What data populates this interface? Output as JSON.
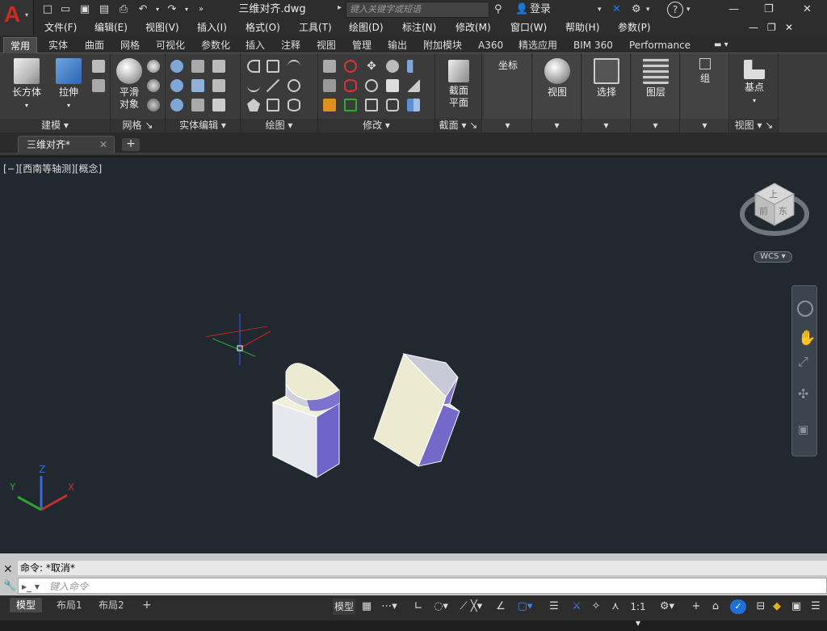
{
  "title_bar": {
    "app_menu_icon": "autocad-logo-icon",
    "document_title": "三维对齐.dwg",
    "search_placeholder": "键入关键字或短语",
    "login_label": "登录",
    "help_icon": "question-icon"
  },
  "menu_bar": {
    "items": [
      "文件(F)",
      "编辑(E)",
      "视图(V)",
      "插入(I)",
      "格式(O)",
      "工具(T)",
      "绘图(D)",
      "标注(N)",
      "修改(M)",
      "窗口(W)",
      "帮助(H)",
      "参数(P)"
    ]
  },
  "ribbon_tabs": {
    "tabs": [
      "常用",
      "实体",
      "曲面",
      "网格",
      "可视化",
      "参数化",
      "插入",
      "注释",
      "视图",
      "管理",
      "输出",
      "附加模块",
      "A360",
      "精选应用",
      "BIM 360",
      "Performance"
    ],
    "active": "常用"
  },
  "ribbon": {
    "panel_labels": [
      "建模",
      "网格",
      "实体编辑",
      "绘图",
      "修改",
      "截面",
      "视图"
    ],
    "buttons": {
      "box": "长方体",
      "extrude": "拉伸",
      "smooth_line1": "平滑",
      "smooth_line2": "对象",
      "section_line1": "截面",
      "section_line2": "平面",
      "coords": "坐标",
      "view": "视图",
      "select": "选择",
      "layers": "图层",
      "group": "组",
      "basepoint": "基点"
    }
  },
  "file_tabs": {
    "active_file": "三维对齐*"
  },
  "viewport": {
    "label": "[−][西南等轴测][概念]",
    "viewcube_top": "上",
    "viewcube_front": "前",
    "viewcube_right": "东",
    "wcs_label": "WCS",
    "axis_x": "X",
    "axis_y": "Y",
    "axis_z": "Z"
  },
  "command": {
    "history": "命令: *取消*",
    "input_placeholder": "键入命令"
  },
  "status_bar": {
    "layout_tabs": [
      "模型",
      "布局1",
      "布局2"
    ],
    "model_label": "模型",
    "scale": "1:1"
  },
  "colors": {
    "background": "#212830",
    "accent": "#1e6fd6",
    "solid_light": "#ecebd2",
    "solid_side": "#8576d0"
  }
}
